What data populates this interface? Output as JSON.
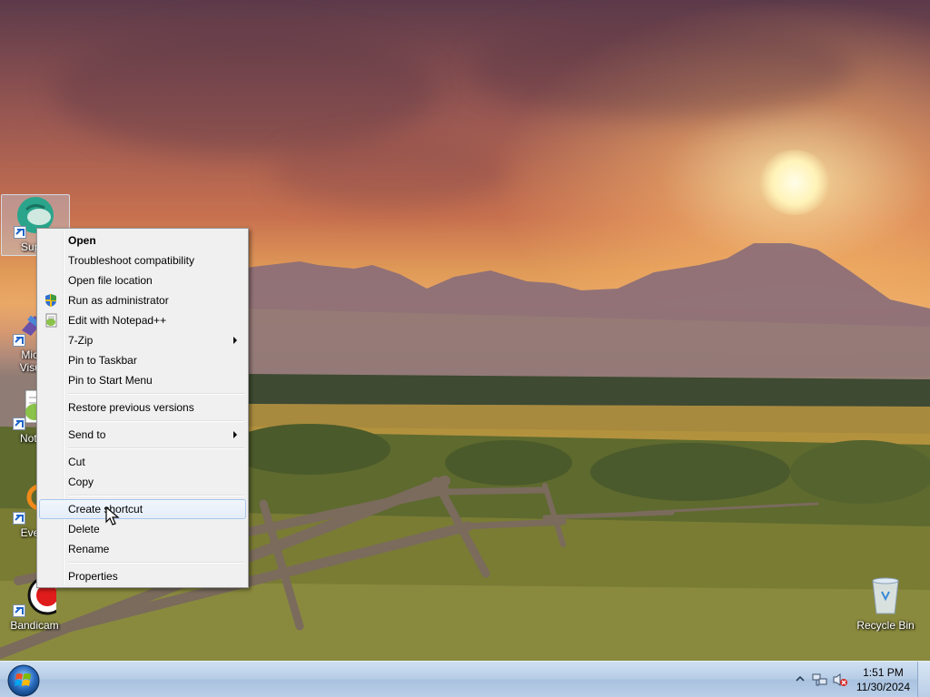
{
  "desktop": {
    "icons": [
      {
        "name": "Super",
        "label": "Super"
      },
      {
        "name": "Microsoft Visual",
        "label_line1": "Micro",
        "label_line2": "Visual"
      },
      {
        "name": "Notepad",
        "label": "Notep"
      },
      {
        "name": "Everything",
        "label": "Every"
      },
      {
        "name": "Bandicam",
        "label": "Bandicam"
      },
      {
        "name": "Recycle Bin",
        "label": "Recycle Bin"
      }
    ]
  },
  "context_menu": {
    "items": [
      {
        "label": "Open",
        "bold": true
      },
      {
        "label": "Troubleshoot compatibility"
      },
      {
        "label": "Open file location"
      },
      {
        "label": "Run as administrator",
        "icon": "uac-shield-icon"
      },
      {
        "label": "Edit with Notepad++",
        "icon": "notepadpp-icon"
      },
      {
        "label": "7-Zip",
        "submenu": true
      },
      {
        "label": "Pin to Taskbar"
      },
      {
        "label": "Pin to Start Menu"
      },
      {
        "label": "Restore previous versions"
      },
      {
        "label": "Send to",
        "submenu": true
      },
      {
        "label": "Cut"
      },
      {
        "label": "Copy"
      },
      {
        "label": "Create shortcut",
        "hovered": true
      },
      {
        "label": "Delete"
      },
      {
        "label": "Rename"
      },
      {
        "label": "Properties"
      }
    ]
  },
  "taskbar": {
    "start_button": "start-orb-icon",
    "tray": {
      "time": "1:51 PM",
      "date": "11/30/2024",
      "icons": [
        "show-hidden-icons-chevron",
        "network-icon",
        "volume-muted-icon"
      ]
    }
  },
  "colors": {
    "menu_bg": "#f0f0f0",
    "menu_hover_border": "#a8c7ec",
    "taskbar": "#b9cfe8"
  }
}
